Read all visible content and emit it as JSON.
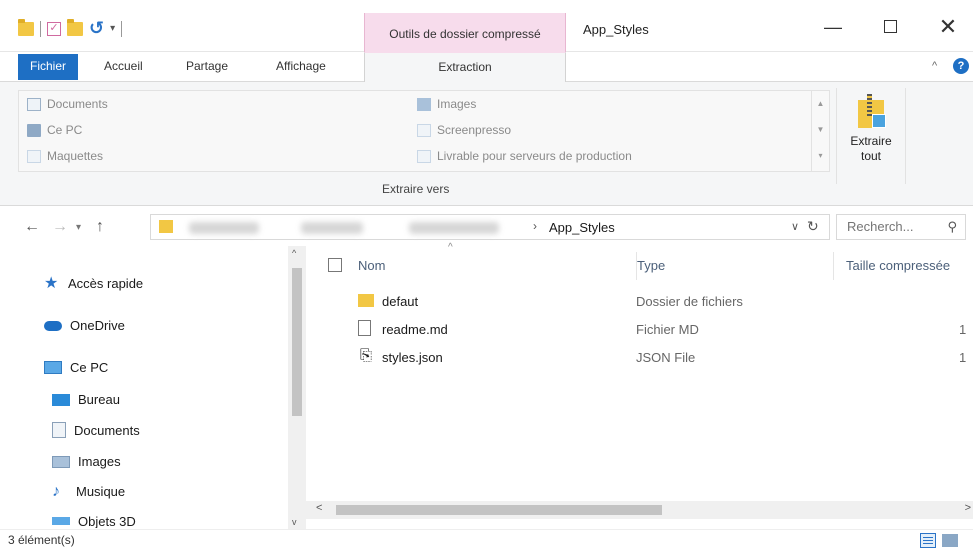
{
  "titlebar": {
    "context_group": "Outils de dossier compressé",
    "window_title": "App_Styles",
    "minimize": "—",
    "close": "✕"
  },
  "tabs": {
    "file": "Fichier",
    "home": "Accueil",
    "share": "Partage",
    "view": "Affichage",
    "extract": "Extraction"
  },
  "ribbon": {
    "destinations_left": [
      "Documents",
      "Ce PC",
      "Maquettes"
    ],
    "destinations_right": [
      "Images",
      "Screenpresso",
      "Livrable pour serveurs de production"
    ],
    "group_label": "Extraire vers",
    "extract_all_line1": "Extraire",
    "extract_all_line2": "tout"
  },
  "address": {
    "current": "App_Styles",
    "search_placeholder": "Recherch..."
  },
  "navpane": {
    "quick_access": "Accès rapide",
    "onedrive": "OneDrive",
    "this_pc": "Ce PC",
    "desktop": "Bureau",
    "documents": "Documents",
    "images": "Images",
    "music": "Musique",
    "objects3d": "Objets 3D"
  },
  "columns": {
    "name": "Nom",
    "type": "Type",
    "size": "Taille compressée"
  },
  "files": [
    {
      "name": "defaut",
      "type": "Dossier de fichiers",
      "size": "",
      "icon": "folder-icon"
    },
    {
      "name": "readme.md",
      "type": "Fichier MD",
      "size": "1",
      "icon": "file-icon"
    },
    {
      "name": "styles.json",
      "type": "JSON File",
      "size": "1",
      "icon": "json-file-icon"
    }
  ],
  "status": {
    "count": "3 élément(s)"
  },
  "colors": {
    "accent": "#1e6fc4",
    "context_pink": "#f7dcec",
    "folder": "#f2c744"
  }
}
